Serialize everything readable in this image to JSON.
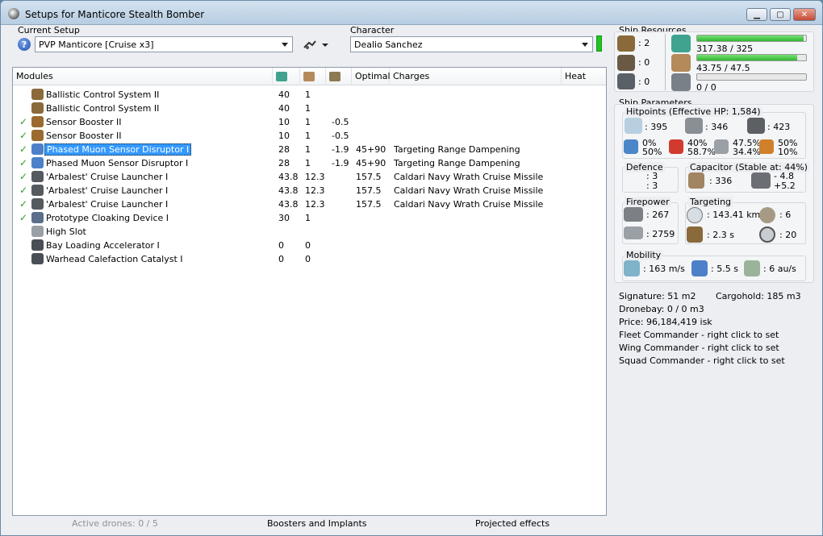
{
  "window": {
    "title": "Setups for Manticore Stealth Bomber"
  },
  "setup": {
    "label": "Current Setup",
    "value": "PVP Manticore [Cruise x3]"
  },
  "character": {
    "label": "Character",
    "value": "Dealio Sanchez"
  },
  "modules": {
    "headers": {
      "name": "Modules",
      "optimal": "Optimal",
      "charges": "Charges",
      "heat": "Heat"
    },
    "rows": [
      {
        "check": "",
        "icon_color": "#8a6a3a",
        "name": "Ballistic Control System II",
        "cpu": "40",
        "power": "1",
        "cap": "",
        "optimal": "",
        "charges": ""
      },
      {
        "check": "",
        "icon_color": "#8a6a3a",
        "name": "Ballistic Control System II",
        "cpu": "40",
        "power": "1",
        "cap": "",
        "optimal": "",
        "charges": ""
      },
      {
        "check": "✓",
        "icon_color": "#9a6a30",
        "name": "Sensor Booster II",
        "cpu": "10",
        "power": "1",
        "cap": "-0.5",
        "optimal": "",
        "charges": ""
      },
      {
        "check": "✓",
        "icon_color": "#9a6a30",
        "name": "Sensor Booster II",
        "cpu": "10",
        "power": "1",
        "cap": "-0.5",
        "optimal": "",
        "charges": ""
      },
      {
        "check": "✓",
        "icon_color": "#4c80c9",
        "name": "Phased Muon Sensor Disruptor I",
        "cpu": "28",
        "power": "1",
        "cap": "-1.9",
        "optimal": "45+90",
        "charges": "Targeting Range Dampening",
        "selected": true
      },
      {
        "check": "✓",
        "icon_color": "#4c80c9",
        "name": "Phased Muon Sensor Disruptor I",
        "cpu": "28",
        "power": "1",
        "cap": "-1.9",
        "optimal": "45+90",
        "charges": "Targeting Range Dampening"
      },
      {
        "check": "✓",
        "icon_color": "#555a5f",
        "name": "'Arbalest' Cruise Launcher I",
        "cpu": "43.8",
        "power": "12.3",
        "cap": "",
        "optimal": "157.5",
        "charges": "Caldari Navy Wrath Cruise Missile"
      },
      {
        "check": "✓",
        "icon_color": "#555a5f",
        "name": "'Arbalest' Cruise Launcher I",
        "cpu": "43.8",
        "power": "12.3",
        "cap": "",
        "optimal": "157.5",
        "charges": "Caldari Navy Wrath Cruise Missile"
      },
      {
        "check": "✓",
        "icon_color": "#555a5f",
        "name": "'Arbalest' Cruise Launcher I",
        "cpu": "43.8",
        "power": "12.3",
        "cap": "",
        "optimal": "157.5",
        "charges": "Caldari Navy Wrath Cruise Missile"
      },
      {
        "check": "✓",
        "icon_color": "#5b6e8a",
        "name": "Prototype Cloaking Device I",
        "cpu": "30",
        "power": "1",
        "cap": "",
        "optimal": "",
        "charges": ""
      },
      {
        "check": "",
        "icon_color": "#9aa0a6",
        "name": "High Slot",
        "cpu": "",
        "power": "",
        "cap": "",
        "optimal": "",
        "charges": ""
      },
      {
        "check": "",
        "icon_color": "#4a4f55",
        "name": "Bay Loading Accelerator I",
        "cpu": "0",
        "power": "0",
        "cap": "",
        "optimal": "",
        "charges": ""
      },
      {
        "check": "",
        "icon_color": "#4a4f55",
        "name": "Warhead Calefaction Catalyst I",
        "cpu": "0",
        "power": "0",
        "cap": "",
        "optimal": "",
        "charges": ""
      }
    ]
  },
  "statusbar": {
    "drones": "Active drones: 0 / 5",
    "boosters": "Boosters and Implants",
    "projected": "Projected effects"
  },
  "resources": {
    "title": "Ship Resources",
    "turret": ": 2",
    "launcher": ": 0",
    "calibration": ": 0",
    "cpu_text": "317.38 / 325",
    "cpu_fill": 0.977,
    "power_text": "43.75 / 47.5",
    "power_fill": 0.921,
    "drone_text": "0 / 0",
    "drone_fill": 0
  },
  "params": {
    "title": "Ship Parameters",
    "hp_title": "Hitpoints (Effective HP: 1,584)",
    "shield_hp": ": 395",
    "armor_hp": ": 346",
    "hull_hp": ": 423",
    "res_em": [
      "0%",
      "50%"
    ],
    "res_thermal": [
      "40%",
      "58.7%"
    ],
    "res_kinetic": [
      "47.5%",
      "34.4%"
    ],
    "res_explosive": [
      "50%",
      "10%"
    ],
    "defence_title": "Defence",
    "defence_a": ": 3",
    "defence_b": ": 3",
    "cap_title": "Capacitor (Stable at: 44%)",
    "cap_amount": ": 336",
    "cap_delta_a": "- 4.8",
    "cap_delta_b": "+5.2",
    "fire_title": "Firepower",
    "dps": ": 267",
    "volley": ": 2759",
    "target_title": "Targeting",
    "target_range": ": 143.41 km",
    "target_count": ": 6",
    "lock_time": ": 2.3 s",
    "scan_res": ": 20",
    "mob_title": "Mobility",
    "speed": ": 163 m/s",
    "align": ": 5.5 s",
    "warp": ": 6 au/s",
    "signature": "Signature: 51 m2",
    "cargo": "Cargohold: 185 m3",
    "dronebay": "Dronebay: 0 / 0 m3",
    "price": "Price: 96,184,419 isk",
    "fleet": "Fleet Commander - right click to set",
    "wing": "Wing Commander - right click to set",
    "squad": "Squad Commander - right click to set"
  }
}
